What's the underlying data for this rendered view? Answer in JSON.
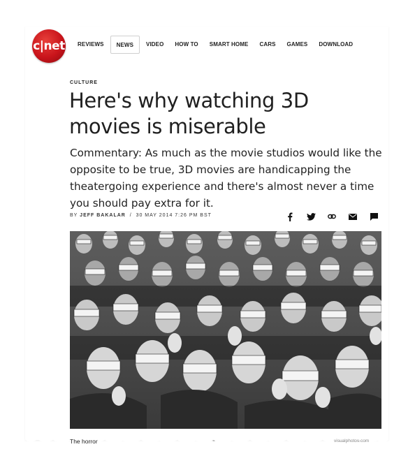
{
  "logo": {
    "text": "c|net"
  },
  "nav": {
    "items": [
      {
        "label": "REVIEWS"
      },
      {
        "label": "NEWS",
        "active": true
      },
      {
        "label": "VIDEO"
      },
      {
        "label": "HOW TO"
      },
      {
        "label": "SMART HOME"
      },
      {
        "label": "CARS"
      },
      {
        "label": "GAMES"
      },
      {
        "label": "DOWNLOAD"
      }
    ]
  },
  "article": {
    "kicker": "CULTURE",
    "headline": "Here's why watching 3D movies is miserable",
    "dek": "Commentary: As much as the movie studios would like the opposite to be true, 3D movies are handicapping the theatergoing experience and there's almost never a time you should pay extra for it.",
    "byline_prefix": "BY",
    "author": "JEFF BAKALAR",
    "separator": "/",
    "date": "30 MAY 2014 7:26 PM BST"
  },
  "share": {
    "icons": [
      "facebook-icon",
      "twitter-icon",
      "link-icon",
      "email-icon",
      "comment-icon"
    ]
  },
  "photo": {
    "caption": "The horror",
    "credit": "visualphotos.com"
  },
  "colors": {
    "brand_red": "#c9141b",
    "text": "#222222",
    "active_border": "#cfcfcf"
  }
}
